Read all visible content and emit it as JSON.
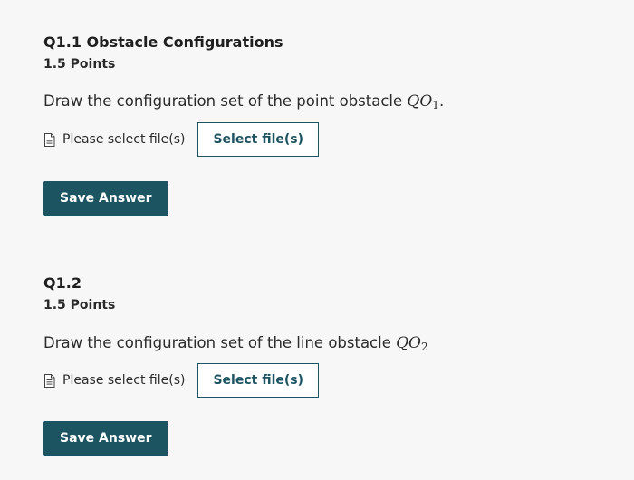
{
  "colors": {
    "background": "#f7f7f7",
    "accent": "#1d5462",
    "text": "#222222"
  },
  "questions": [
    {
      "title": "Q1.1 Obstacle Configurations",
      "points": "1.5 Points",
      "prompt_text": "Draw the configuration set of the point obstacle ",
      "prompt_math": "QO",
      "prompt_math_sub": "1",
      "prompt_suffix": ".",
      "file_status": "Please select file(s)",
      "select_button": "Select file(s)",
      "save_button": "Save Answer",
      "file_icon": "document-icon"
    },
    {
      "title": "Q1.2",
      "points": "1.5 Points",
      "prompt_text": "Draw the configuration set of the line obstacle ",
      "prompt_math": "QO",
      "prompt_math_sub": "2",
      "prompt_suffix": "",
      "file_status": "Please select file(s)",
      "select_button": "Select file(s)",
      "save_button": "Save Answer",
      "file_icon": "document-icon"
    }
  ]
}
